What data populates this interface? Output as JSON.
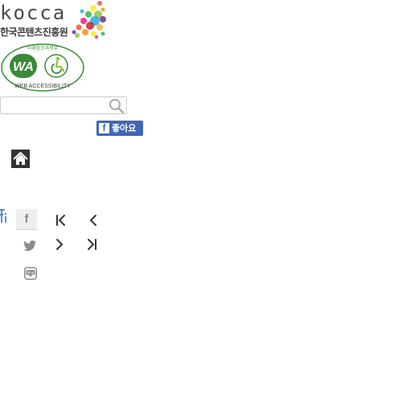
{
  "logo": {
    "wordmark": "kocca",
    "subtitle": "한국콘텐츠진흥원",
    "dot_colors": [
      "#f15a24",
      "#f7931e",
      "#fcee21",
      "#8cc63f",
      "#39b54a",
      "#29abe2",
      "#662d91",
      "#ed1e79",
      "#c1272d",
      "#fbb03b"
    ]
  },
  "wa_badge": {
    "mark": "WA",
    "top_text": "미래창조과학부",
    "bottom_text": "WEB ACCESSIBILITY",
    "color": "#3a8a3a"
  },
  "search": {
    "value": "",
    "placeholder": ""
  },
  "facebook_like": {
    "icon": "f",
    "label": "좋아요",
    "color": "#4267b2"
  },
  "sns": {
    "facebook_icon": "f",
    "twitter_icon": "twitter-bird-icon",
    "blog_icon": "blog",
    "blog_label": "blog"
  },
  "pager": {
    "first_icon": "first-page-icon",
    "prev_icon": "chevron-left-icon",
    "next_icon": "chevron-right-icon",
    "last_icon": "last-page-icon"
  },
  "colors": {
    "text_dark": "#4a4a4a",
    "home_bg": "#333333",
    "icon_gray": "#8c8c8c"
  }
}
